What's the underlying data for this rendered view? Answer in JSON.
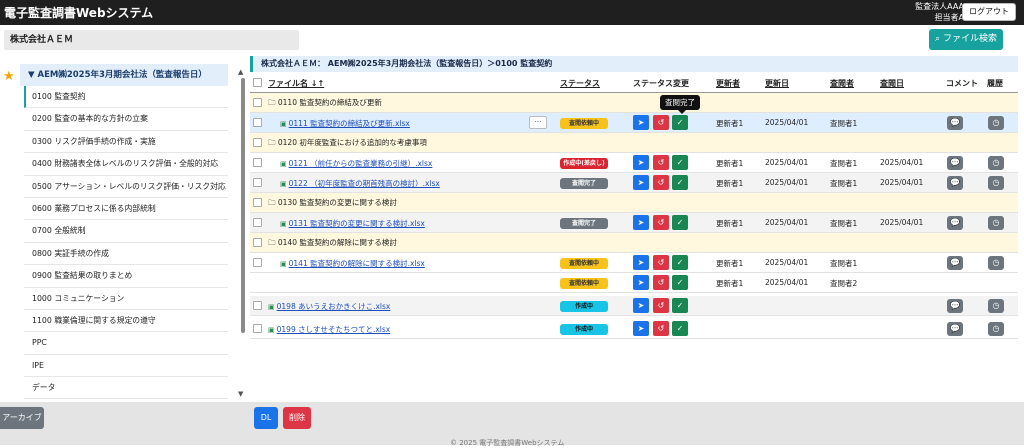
{
  "header": {
    "app_title": "電子監査調書Webシステム",
    "user_line1": "監査法人AAA",
    "user_line2": "担当者A",
    "logout_label": "ログアウト"
  },
  "subbar": {
    "company": "株式会社ＡＥＭ",
    "file_search_label": "ファイル検索"
  },
  "sidebar": {
    "tree_header": "AEM㈱2025年3月期会社法（監査報告日）",
    "items": [
      "0100 監査契約",
      "0200 監査の基本的な方針の立案",
      "0300 リスク評価手続の作成・実施",
      "0400 財務諸表全体レベルのリスク評価・全般的対応",
      "0500 アサーション・レベルのリスク評価・リスク対応",
      "0600 業務プロセスに係る内部統制",
      "0700 全般統制",
      "0800 実証手続の作成",
      "0900 監査結果の取りまとめ",
      "1000 コミュニケーション",
      "1100 職業倫理に関する規定の遵守",
      "PPC",
      "IPE",
      "データ"
    ]
  },
  "main": {
    "breadcrumb": "株式会社ＡＥＭ： AEM㈱2025年3月期会社法（監査報告日）＞0100 監査契約",
    "columns": {
      "filename": "ファイル名 ↓↑",
      "status": "ステータス",
      "status_change": "ステータス変更",
      "updater": "更新者",
      "updated": "更新日",
      "reviewer": "査閲者",
      "reviewed": "査閲日",
      "comment": "コメント",
      "history": "履歴"
    },
    "tooltip": "査閲完了",
    "rows": [
      {
        "type": "folder",
        "name": "0110 監査契約の締結及び更新"
      },
      {
        "type": "file",
        "name": "0111 監査契約の締結及び更新.xlsx",
        "status": "査閲依頼中",
        "status_color": "yellow",
        "updater": "更新者1",
        "updated": "2025/04/01",
        "reviewer": "査閲者1",
        "reviewed": ""
      },
      {
        "type": "folder",
        "name": "0120 初年度監査における追加的な考慮事項"
      },
      {
        "type": "file",
        "name": "0121 （前任からの監査業務の引継）.xlsx",
        "status": "作成中(差戻し)",
        "status_color": "red",
        "updater": "更新者1",
        "updated": "2025/04/01",
        "reviewer": "査閲者1",
        "reviewed": "2025/04/01"
      },
      {
        "type": "file",
        "name": "0122 （初年度監査の期首残高の検討）.xlsx",
        "status": "査閲完了",
        "status_color": "gray",
        "updater": "更新者1",
        "updated": "2025/04/01",
        "reviewer": "査閲者1",
        "reviewed": "2025/04/01"
      },
      {
        "type": "folder",
        "name": "0130 監査契約の変更に関する検討"
      },
      {
        "type": "file",
        "name": "0131 監査契約の変更に関する検討.xlsx",
        "status": "査閲完了",
        "status_color": "gray",
        "updater": "更新者1",
        "updated": "2025/04/01",
        "reviewer": "査閲者1",
        "reviewed": "2025/04/01"
      },
      {
        "type": "folder",
        "name": "0140 監査契約の解除に関する検討"
      },
      {
        "type": "file",
        "name": "0141 監査契約の解除に関する検討.xlsx",
        "status": "査閲依頼中",
        "status_color": "yellow",
        "updater": "更新者1",
        "updated": "2025/04/01",
        "reviewer": "査閲者1",
        "reviewed": ""
      },
      {
        "type": "file",
        "name": "",
        "status": "査閲依頼中",
        "status_color": "yellow",
        "updater": "更新者1",
        "updated": "2025/04/01",
        "reviewer": "査閲者2",
        "reviewed": ""
      },
      {
        "type": "file",
        "name": "0198 あいうえおかきくけこ.xlsx",
        "status": "作成中",
        "status_color": "cyan",
        "updater": "",
        "updated": "",
        "reviewer": "",
        "reviewed": ""
      },
      {
        "type": "file",
        "name": "0199 さしすせそたちつてと.xlsx",
        "status": "作成中",
        "status_color": "cyan",
        "updater": "",
        "updated": "",
        "reviewer": "",
        "reviewed": ""
      }
    ]
  },
  "footer": {
    "archive_label": "アーカイブ",
    "dl_label": "DL",
    "delete_label": "削除",
    "copyright": "© 2025 電子監査調書Webシステム"
  },
  "colors": {
    "accent": "#17a2a0",
    "folder_bg": "#fff8df",
    "selected_bg": "#dfeeff"
  }
}
